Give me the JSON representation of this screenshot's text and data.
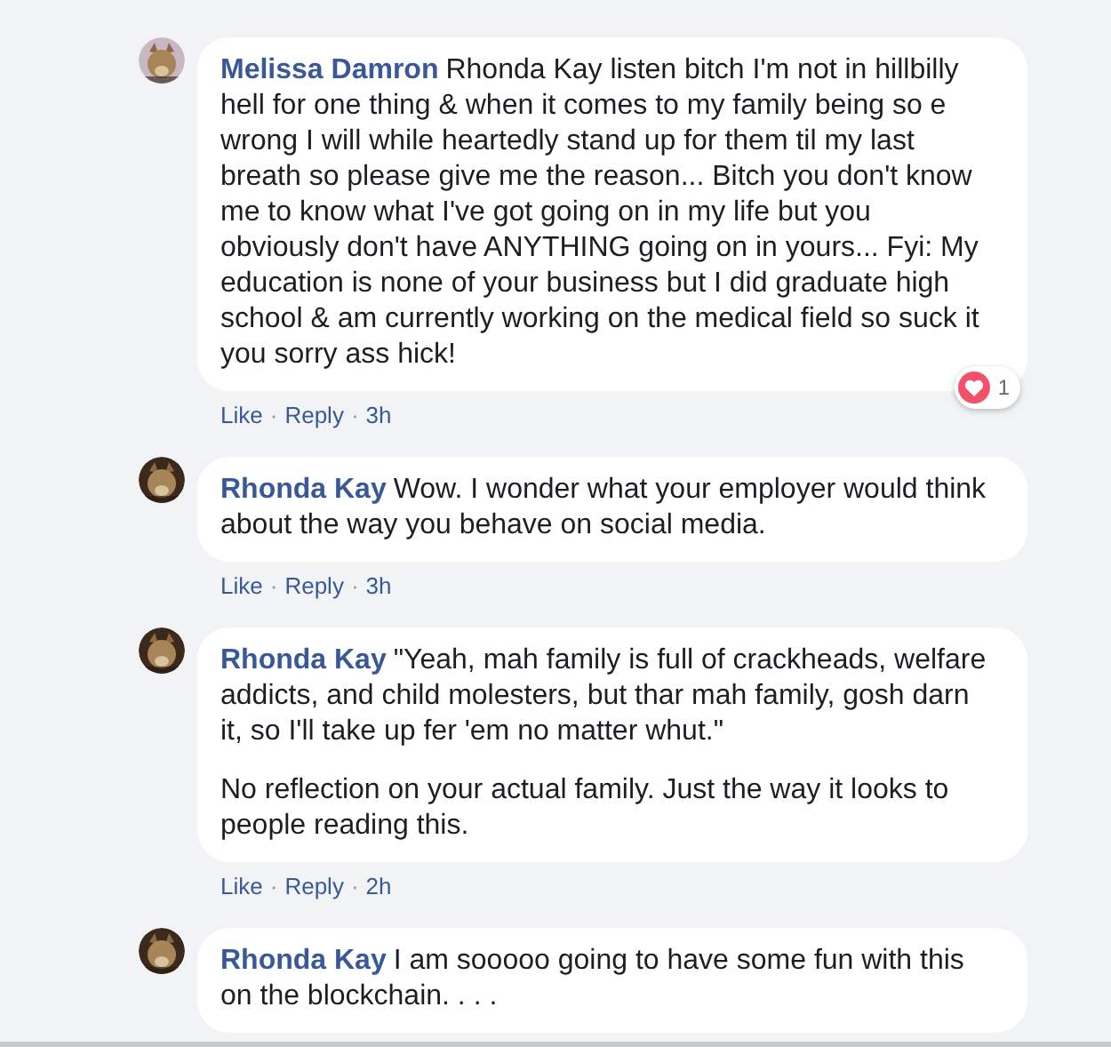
{
  "comments": [
    {
      "author": "Melissa Damron",
      "paragraphs": [
        "Rhonda Kay listen bitch I'm not in hillbilly hell for one thing & when it comes to my family being so e wrong I will while heartedly stand up for them til my last breath so please give me the reason... Bitch you don't know me to know what I've got going on in my life but you obviously don't have ANYTHING going on in yours... Fyi: My education is none of your business but I did graduate high school & am currently working on the medical field so suck it you sorry ass hick!"
      ],
      "reaction_count": "1",
      "avatar": {
        "kind": "picture",
        "color": "#c9b8c4"
      },
      "actions": [
        {
          "kind": "link",
          "text": "Like"
        },
        {
          "kind": "dot",
          "text": "·"
        },
        {
          "kind": "link",
          "text": "Reply"
        },
        {
          "kind": "dot",
          "text": "·"
        },
        {
          "kind": "time",
          "text": "3h"
        }
      ]
    },
    {
      "author": "Rhonda Kay",
      "paragraphs": [
        "Wow. I wonder what your employer would think about the way you behave on social media."
      ],
      "avatar": {
        "kind": "picture",
        "color": "#3b2a1c"
      },
      "actions": [
        {
          "kind": "link",
          "text": "Like"
        },
        {
          "kind": "dot",
          "text": "·"
        },
        {
          "kind": "link",
          "text": "Reply"
        },
        {
          "kind": "dot",
          "text": "·"
        },
        {
          "kind": "time",
          "text": "3h"
        }
      ]
    },
    {
      "author": "Rhonda Kay",
      "paragraphs": [
        "\"Yeah, mah family is full of crackheads, welfare addicts, and child molesters, but thar mah family, gosh darn it, so I'll take up fer 'em no matter whut.\"",
        "No reflection on your actual family. Just the way it looks to people reading this."
      ],
      "avatar": {
        "kind": "picture",
        "color": "#3b2a1c"
      },
      "actions": [
        {
          "kind": "link",
          "text": "Like"
        },
        {
          "kind": "dot",
          "text": "·"
        },
        {
          "kind": "link",
          "text": "Reply"
        },
        {
          "kind": "dot",
          "text": "·"
        },
        {
          "kind": "time",
          "text": "2h"
        }
      ]
    },
    {
      "author": "Rhonda Kay",
      "paragraphs": [
        "I am sooooo going to have some fun with this on the blockchain. . . ."
      ],
      "avatar": {
        "kind": "picture",
        "color": "#3b2a1c"
      }
    }
  ]
}
